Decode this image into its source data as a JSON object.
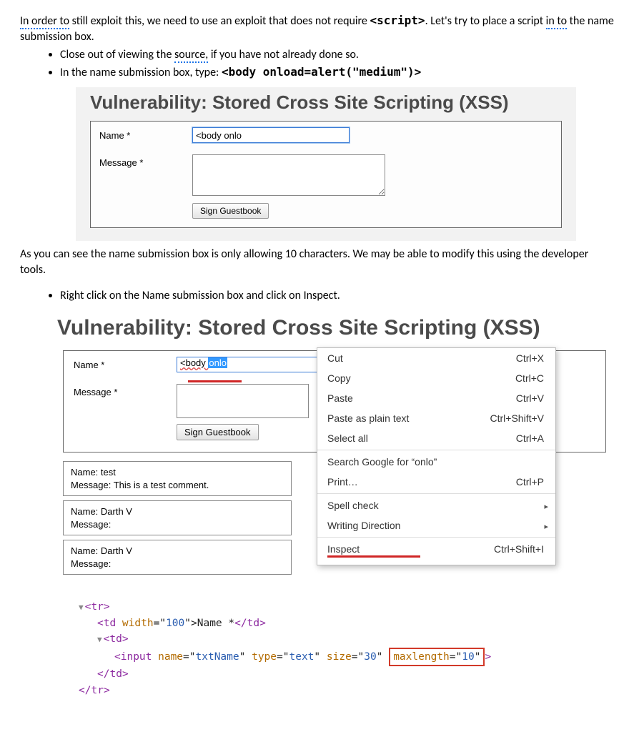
{
  "intro": {
    "p1_a": "In order to",
    "p1_b": " still exploit this, we need to use an exploit that does not require ",
    "p1_code": "<script>",
    "p1_c": ". Let's try to place a script ",
    "p1_d": "in to",
    "p1_e": " the name submission box."
  },
  "bullets1": {
    "b1_a": "Close out of viewing the ",
    "b1_src": "source,",
    "b1_b": " if you have not already done so.",
    "b2_a": "In the name submission box, type: ",
    "b2_code": "<body onload=alert(\"medium\")>"
  },
  "dvwa1": {
    "heading": "Vulnerability: Stored Cross Site Scripting (XSS)",
    "name_label": "Name *",
    "name_value": "<body onlo",
    "msg_label": "Message *",
    "sign_label": "Sign Guestbook"
  },
  "mid_paragraph": "As you can see the name submission box is only allowing 10 characters. We may be able to modify this using the developer tools.",
  "bullets2": {
    "b1": "Right click on the Name submission box and click on Inspect."
  },
  "dvwa2": {
    "heading": "Vulnerability: Stored Cross Site Scripting (XSS)",
    "name_label": "Name *",
    "name_typed_plain": "<body ",
    "name_typed_sel": "onlo",
    "msg_label": "Message *",
    "sign_label": "Sign Guestbook",
    "entries": [
      {
        "name": "Name: test",
        "msg": "Message: This is a test comment."
      },
      {
        "name": "Name: Darth V",
        "msg": "Message:"
      },
      {
        "name": "Name: Darth V",
        "msg": "Message:"
      }
    ]
  },
  "ctx": {
    "cut": "Cut",
    "cut_k": "Ctrl+X",
    "copy": "Copy",
    "copy_k": "Ctrl+C",
    "paste": "Paste",
    "paste_k": "Ctrl+V",
    "pasteplain": "Paste as plain text",
    "pasteplain_k": "Ctrl+Shift+V",
    "selectall": "Select all",
    "selectall_k": "Ctrl+A",
    "search": "Search Google for “onlo”",
    "print": "Print…",
    "print_k": "Ctrl+P",
    "spell": "Spell check",
    "writing": "Writing Direction",
    "inspect": "Inspect",
    "inspect_k": "Ctrl+Shift+I"
  },
  "code": {
    "l1_open": "<",
    "l1_tag": "tr",
    "l1_close": ">",
    "l2_open": "<",
    "l2_tag": "td",
    "l2_attr": " width",
    "l2_eq": "=\"",
    "l2_val": "100",
    "l2_q2": "\">",
    "l2_text": "Name *",
    "l2_end": "</",
    "l2_endtag": "td",
    "l2_endc": ">",
    "l3_open": "<",
    "l3_tag": "td",
    "l3_close": ">",
    "l4_open": "<",
    "l4_tag": "input",
    "l4_a1": " name",
    "l4_v1": "txtName",
    "l4_a2": " type",
    "l4_v2": "text",
    "l4_a3": " size",
    "l4_v3": "30",
    "l4_a4": "maxlength",
    "l4_v4": "10",
    "l4_end": ">",
    "l5": "</",
    "l5_tag": "td",
    "l5_c": ">",
    "l6": "</",
    "l6_tag": "tr",
    "l6_c": ">"
  }
}
